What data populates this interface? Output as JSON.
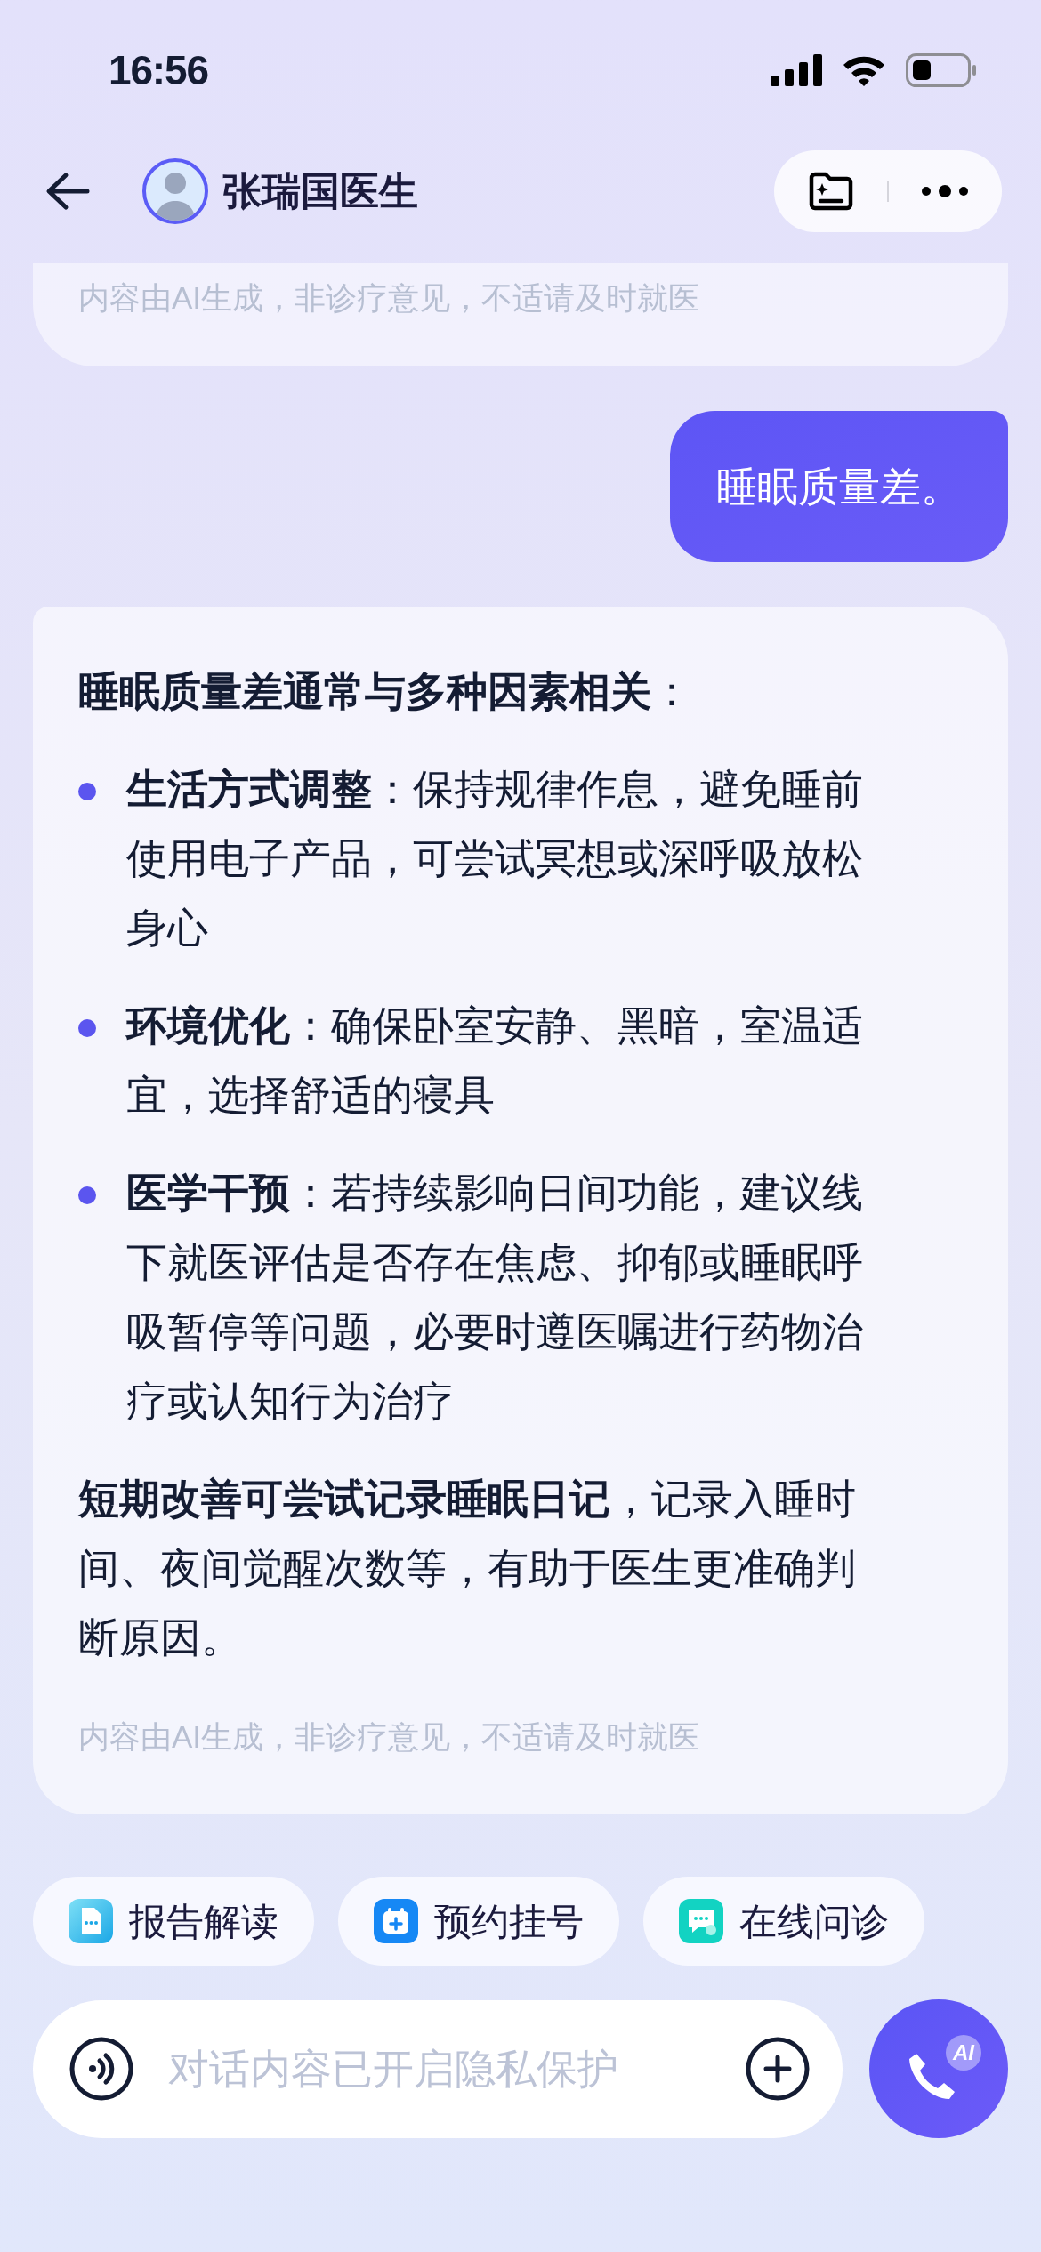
{
  "status_bar": {
    "time": "16:56"
  },
  "header": {
    "title": "张瑞国医生"
  },
  "messages": [
    {
      "kind": "ai",
      "cut_top": true,
      "disclaimer": "内容由AI生成，非诊疗意见，不适请及时就医"
    },
    {
      "kind": "user",
      "text": "睡眠质量差。"
    },
    {
      "kind": "ai",
      "cut_top": false,
      "blocks": [
        {
          "kind": "paragraph",
          "text": "**睡眠质量差通常与多种因素相关**："
        },
        {
          "kind": "bullet",
          "text": "**生活方式调整**：保持规律作息，避免睡前使用电子产品，可尝试冥想或深呼吸放松身心"
        },
        {
          "kind": "bullet",
          "text": "**环境优化**：确保卧室安静、黑暗，室温适宜，选择舒适的寝具"
        },
        {
          "kind": "bullet",
          "text": "**医学干预**：若持续影响日间功能，建议线下就医评估是否存在焦虑、抑郁或睡眠呼吸暂停等问题，必要时遵医嘱进行药物治疗或认知行为治疗"
        },
        {
          "kind": "paragraph",
          "text": "**短期改善可尝试记录睡眠日记**，记录入睡时间、夜间觉醒次数等，有助于医生更准确判断原因。"
        }
      ],
      "disclaimer": "内容由AI生成，非诊疗意见，不适请及时就医"
    }
  ],
  "quick_actions": [
    {
      "label": "报告解读"
    },
    {
      "label": "预约挂号"
    },
    {
      "label": "在线问诊"
    }
  ],
  "input": {
    "placeholder": "对话内容已开启隐私保护"
  },
  "call_button": {
    "badge": "AI"
  }
}
